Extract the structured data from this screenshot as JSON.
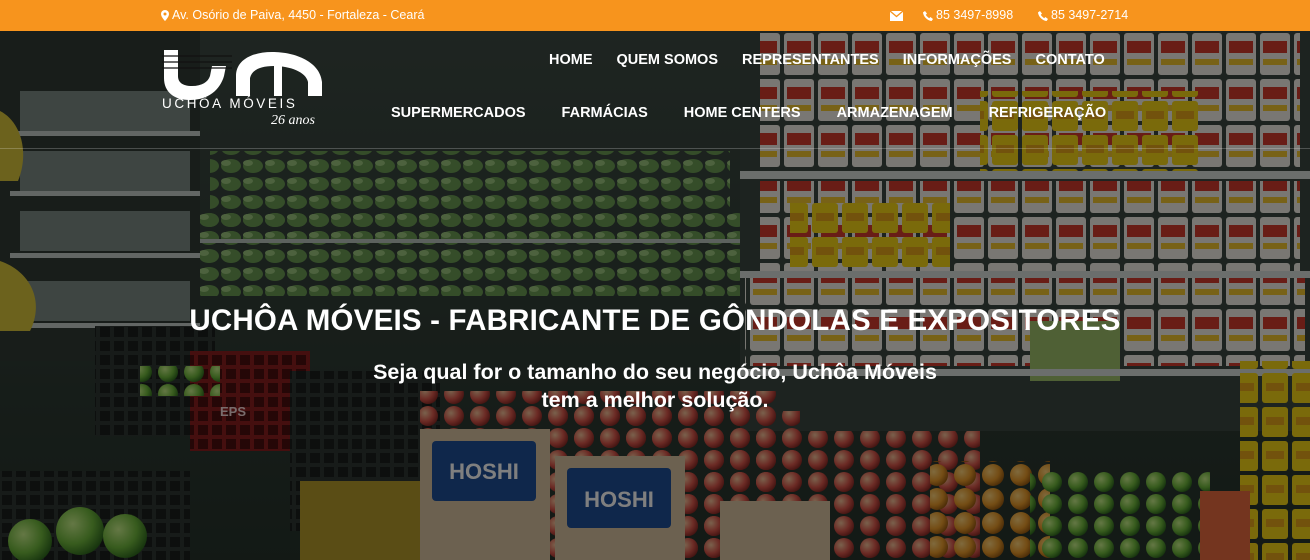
{
  "topbar": {
    "address": "Av. Osório de Paiva, 4450 - Fortaleza - Ceará",
    "phone_1": "85 3497-8998",
    "phone_2": "85 3497-2714",
    "icons": [
      "map-marker-icon",
      "envelope-icon",
      "phone-icon",
      "phone-icon"
    ],
    "background_color": "#f7941d"
  },
  "logo": {
    "name": "UCHÔA MÓVEIS",
    "tagline": "26 anos"
  },
  "nav": {
    "primary": [
      "HOME",
      "QUEM SOMOS",
      "REPRESENTANTES",
      "INFORMAÇÕES",
      "CONTATO"
    ],
    "secondary": [
      "SUPERMERCADOS",
      "FARMÁCIAS",
      "HOME CENTERS",
      "ARMAZENAGEM",
      "REFRIGERAÇÃO"
    ]
  },
  "hero": {
    "title": "UCHÔA MÓVEIS - FABRICANTE DE GÔNDOLAS E EXPOSITORES",
    "subtitle_line_1": "Seja qual for o tamanho do seu negócio, Uchôa Móveis",
    "subtitle_line_2": "tem a melhor solução.",
    "brand_on_crates": "HOSHI",
    "brand_on_crates_2": "EPS"
  }
}
